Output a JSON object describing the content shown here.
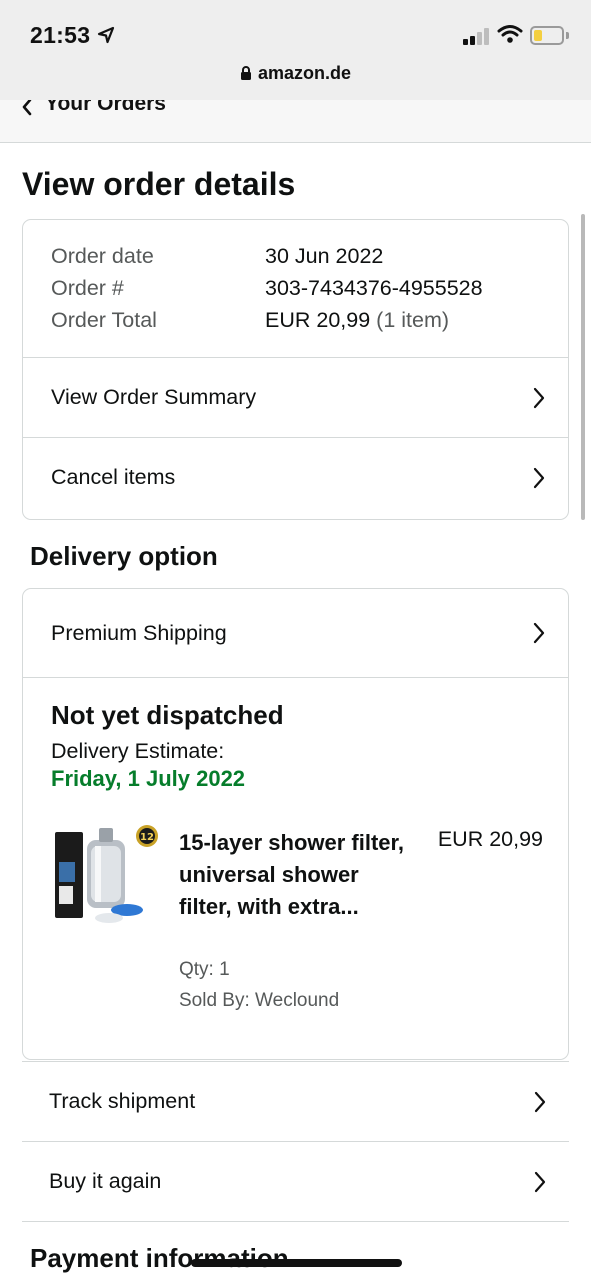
{
  "status_bar": {
    "time": "21:53",
    "battery_color": "#f4cf3f",
    "battery_level": 0.3
  },
  "browser": {
    "url": "amazon.de"
  },
  "nav": {
    "back_label": "Your Orders"
  },
  "page": {
    "title": "View order details"
  },
  "order_summary": {
    "rows": [
      {
        "label": "Order date",
        "value": "30 Jun 2022",
        "note": ""
      },
      {
        "label": "Order #",
        "value": "303-7434376-4955528",
        "note": ""
      },
      {
        "label": "Order Total",
        "value": "EUR 20,99",
        "note": "(1 item)"
      }
    ],
    "view_summary_label": "View Order Summary",
    "cancel_label": "Cancel items"
  },
  "delivery": {
    "section_title": "Delivery option",
    "shipping_method": "Premium Shipping",
    "status": "Not yet dispatched",
    "estimate_label": "Delivery Estimate:",
    "estimate_date": "Friday, 1 July 2022",
    "estimate_color": "#067d2b",
    "item": {
      "name": "15-layer shower filter, universal shower filter, with extra...",
      "price": "EUR 20,99",
      "qty": "Qty: 1",
      "seller": "Sold By: Weclound",
      "badge": "12"
    }
  },
  "actions": {
    "track": "Track shipment",
    "buy_again": "Buy it again"
  },
  "payment": {
    "section_title": "Payment information"
  }
}
